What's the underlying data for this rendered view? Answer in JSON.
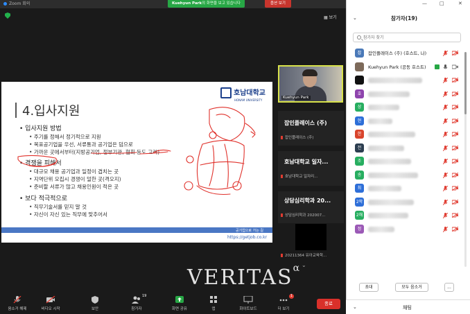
{
  "window": {
    "title": "Zoom 회의"
  },
  "share_banner": {
    "presenter": "Kuehyun Park",
    "suffix": "의 화면을 보고 있습니다",
    "options_label": "옵션 보기"
  },
  "view_button": "보기",
  "slide": {
    "title": "4.입사지원",
    "logo_name": "호남대학교",
    "logo_sub": "HONAM UNIVERSITY",
    "sections": [
      {
        "heading": "입사지원 방법",
        "items": [
          "주기를 정해서 정기적으로 지원",
          "목표공기업을 우선, 서류통과 공기업은 덤으로",
          "가까운 곳에서부터(지방공기업, 정부기관, 협회 등도 고려)"
        ]
      },
      {
        "heading": "경쟁을 피해서",
        "items": [
          "대규모 채용 공기업과 일정이 겹치는 곳",
          "지역단위 모집시 경쟁이 덜한 곳(격오지)",
          "준비할 서류가 많고 채용인원이 적은 곳"
        ]
      },
      {
        "heading": "보다 적극적으로",
        "items": [
          "직무기술서를 믿지 말 것",
          "자신이 자신 있는 직무에 맞추어서"
        ]
      }
    ],
    "footer_brand": "공기업으로 가는 길",
    "footer_url": "https://getjob.co.kr"
  },
  "video_tiles": {
    "camera_label": "Kuehyun Park",
    "tiles": [
      {
        "name": "잡인플레이스 (주)",
        "sub": "잡인플레이스 (주)"
      },
      {
        "name": "호남대학교 일자...",
        "sub": "호남대학교 일자리..."
      },
      {
        "name": "상담심리학과 20...",
        "sub": "상담심리학과 202007..."
      }
    ],
    "last_sub": "20211364 유아교육학..."
  },
  "watermark": {
    "text": "VERITAS",
    "sup": "α"
  },
  "toolbar": {
    "mute": "음소거 해제",
    "video": "비디오 시작",
    "security": "보안",
    "participants": "참가자",
    "participants_count": "19",
    "share": "화면 공유",
    "apps": "앱",
    "whiteboard": "화이트보드",
    "more": "더 보기",
    "more_badge": "1",
    "end": "종료"
  },
  "panel": {
    "title": "참가자(19)",
    "search_placeholder": "참가자 찾기",
    "participants": [
      {
        "avatar": "잡",
        "color": "#4a79b8",
        "name": "잡인플레이스 (주) (호스트, 나)"
      },
      {
        "avatar": "",
        "color": "#7d6a5a",
        "name": "Kuehyun Park (공동 호스트)"
      },
      {
        "avatar": "",
        "color": "#111111",
        "name": ""
      },
      {
        "avatar": "호",
        "color": "#8e44ad",
        "name": ""
      },
      {
        "avatar": "상",
        "color": "#27ae60",
        "name": ""
      },
      {
        "avatar": "현",
        "color": "#2e6fd8",
        "name": ""
      },
      {
        "avatar": "한",
        "color": "#d9442c",
        "name": ""
      },
      {
        "avatar": "전",
        "color": "#2c3e50",
        "name": ""
      },
      {
        "avatar": "조",
        "color": "#27ae60",
        "name": ""
      },
      {
        "avatar": "송",
        "color": "#27ae60",
        "name": ""
      },
      {
        "avatar": "최",
        "color": "#2e6fd8",
        "name": ""
      },
      {
        "avatar": "2학",
        "color": "#2e6fd8",
        "name": ""
      },
      {
        "avatar": "2해",
        "color": "#27ae60",
        "name": ""
      },
      {
        "avatar": "정",
        "color": "#9b59b6",
        "name": ""
      }
    ],
    "invite_label": "초대",
    "mute_all_label": "모두 음소거",
    "more_label": "...",
    "chat_label": "채팅"
  },
  "colors": {
    "share_green": "#27a745",
    "end_red": "#d9302a",
    "muted_red": "#e03c31",
    "slide_footer": "#4a77c4"
  }
}
